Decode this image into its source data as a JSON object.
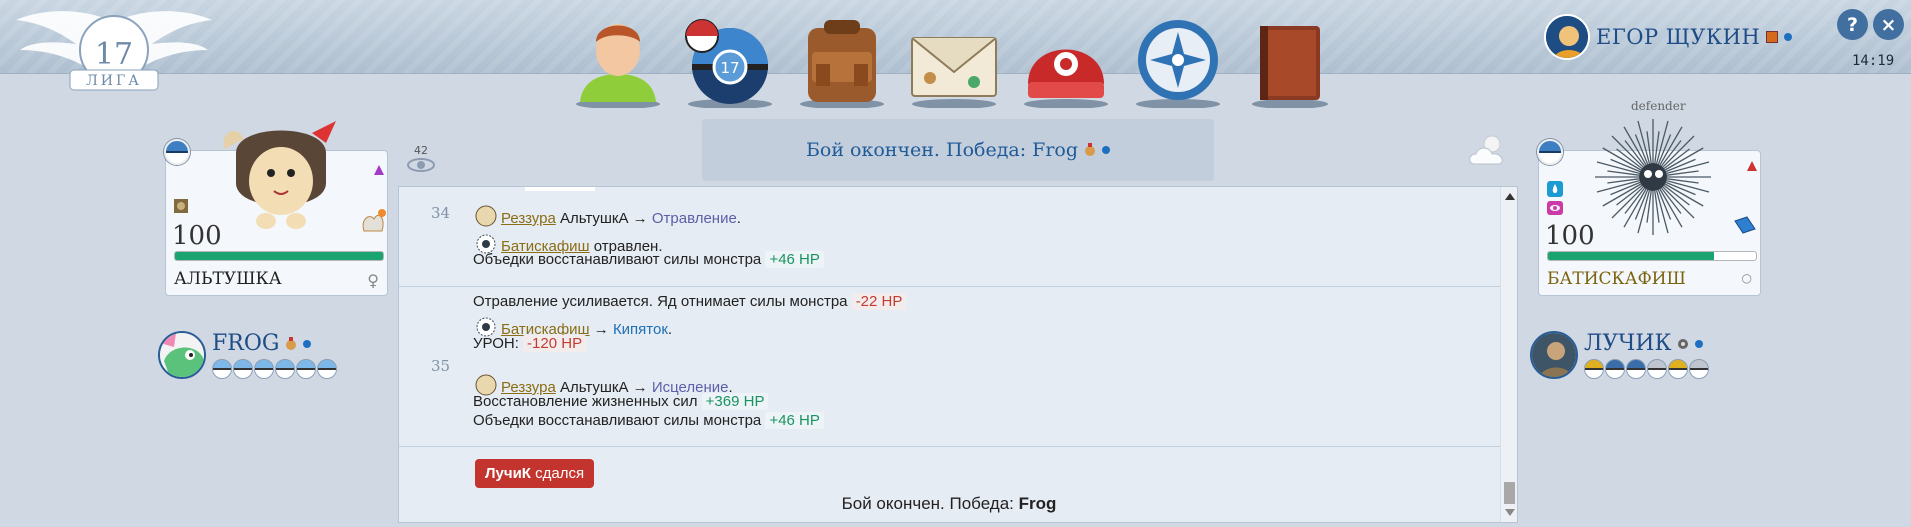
{
  "header": {
    "league_number": "17",
    "league_label": "ЛИГА",
    "nav": [
      {
        "icon": "trainer-icon"
      },
      {
        "icon": "pokeball-17-icon"
      },
      {
        "icon": "backpack-icon"
      },
      {
        "icon": "mail-icon"
      },
      {
        "icon": "cap-icon"
      },
      {
        "icon": "league-icon"
      },
      {
        "icon": "book-icon"
      }
    ],
    "user_name": "ЕГОР ЩУКИН",
    "help_label": "?",
    "close_label": "×",
    "time": "14:19"
  },
  "status": {
    "text": "Бой окончен. Победа: Frog"
  },
  "spectators": "42",
  "weather_icon": "cloud-sun-icon",
  "left_monster": {
    "name": "АЛЬТУШКА",
    "level": "100",
    "hp_fraction": 1.0,
    "gender": "♀"
  },
  "right_monster": {
    "name": "БАТИСКАФИШ",
    "level": "100",
    "hp_fraction": 0.8,
    "tag": "defender"
  },
  "left_trainer": {
    "name": "FROG",
    "balls": 6
  },
  "right_trainer": {
    "name": "ЛУЧИК",
    "balls": 6
  },
  "log": {
    "turn34": "34",
    "turn35": "35",
    "t34_l1_actor": "Реззура",
    "t34_l1_mid": " АльтушкА → ",
    "t34_l1_move": "Отравление",
    "t34_l1_end": ".",
    "t34_l2_actor": "Батискафиш",
    "t34_l2_text": " отравлен.",
    "t34_l3_text": "Объедки восстанавливают силы монстра",
    "t34_l3_val": "+46 HP",
    "t35_l1_text": "Отравление усиливается. Яд отнимает силы монстра",
    "t35_l1_val": "-22 HP",
    "t35_l2_actor": "Батискафиш",
    "t35_l2_mid": " → ",
    "t35_l2_move": "Кипяток",
    "t35_l2_end": ".",
    "t35_l3_text": "УРОН:",
    "t35_l3_val": "-120 HP",
    "t35_l4_actor": "Реззура",
    "t35_l4_mid": " АльтушкА → ",
    "t35_l4_move": "Исцеление",
    "t35_l4_end": ".",
    "t35_l5_text": "Восстановление жизненных сил",
    "t35_l5_val": "+369 HP",
    "t35_l6_text": "Объедки восстанавливают силы монстра",
    "t35_l6_val": "+46 HP",
    "surrender_name": "ЛучиК",
    "surrender_text": " сдался",
    "final_text": "Бой окончен. Победа: ",
    "final_winner": "Frog"
  },
  "colors": {
    "accent": "#1e4c86",
    "hp": "#1aa471",
    "surrender": "#c4342e"
  }
}
